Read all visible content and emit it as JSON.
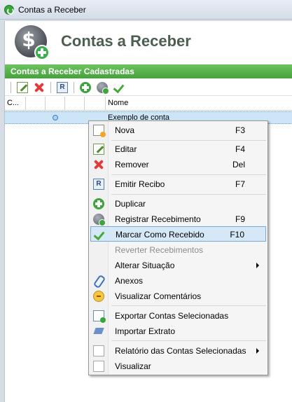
{
  "titlebar": {
    "title": "Contas a Receber"
  },
  "header": {
    "title": "Contas a Receber"
  },
  "section": {
    "title": "Contas a Receber Cadastradas"
  },
  "grid": {
    "columns": [
      "C...",
      "",
      "",
      "",
      "",
      "Nome"
    ],
    "rows": [
      {
        "nome": "Exemplo de conta"
      }
    ]
  },
  "menu": {
    "items": [
      {
        "label": "Nova",
        "shortcut": "F3",
        "icon": "new-document-icon"
      },
      {
        "label": "Editar",
        "shortcut": "F4",
        "icon": "edit-icon"
      },
      {
        "label": "Remover",
        "shortcut": "Del",
        "icon": "delete-icon"
      },
      {
        "label": "Emitir Recibo",
        "shortcut": "F7",
        "icon": "receipt-icon"
      },
      {
        "label": "Duplicar",
        "shortcut": "",
        "icon": "add-icon"
      },
      {
        "label": "Registrar Recebimento",
        "shortcut": "F9",
        "icon": "coin-icon"
      },
      {
        "label": "Marcar Como Recebido",
        "shortcut": "F10",
        "icon": "check-icon"
      },
      {
        "label": "Reverter Recebimentos",
        "shortcut": "",
        "icon": ""
      },
      {
        "label": "Alterar Situação",
        "shortcut": "",
        "icon": ""
      },
      {
        "label": "Anexos",
        "shortcut": "",
        "icon": "paperclip-icon"
      },
      {
        "label": "Visualizar Comentários",
        "shortcut": "",
        "icon": "comment-icon"
      },
      {
        "label": "Exportar Contas Selecionadas",
        "shortcut": "",
        "icon": "export-icon"
      },
      {
        "label": "Importar Extrato",
        "shortcut": "",
        "icon": "import-icon"
      },
      {
        "label": "Relatório das Contas Selecionadas",
        "shortcut": "",
        "icon": "report-icon"
      },
      {
        "label": "Visualizar",
        "shortcut": "",
        "icon": "view-icon"
      }
    ]
  }
}
